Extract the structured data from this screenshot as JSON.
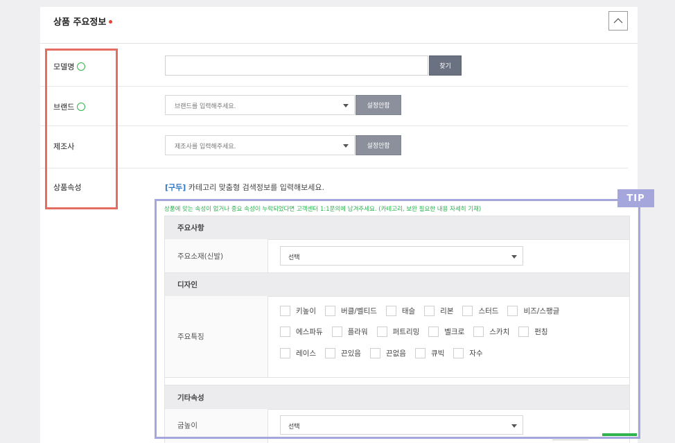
{
  "section": {
    "title": "상품 주요정보",
    "required_color": "#e8412f",
    "collapse_icon": "chevron-up-icon"
  },
  "fields": {
    "model": {
      "label": "모델명",
      "value": "",
      "search_button": "찾기"
    },
    "brand": {
      "label": "브랜드",
      "placeholder": "브랜드를 입력해주세요.",
      "setting_button": "설정안함"
    },
    "maker": {
      "label": "제조사",
      "placeholder": "제조사를 입력해주세요.",
      "setting_button": "설정안함"
    },
    "attributes": {
      "label": "상품속성",
      "guide_tag": "[구두]",
      "guide_text": " 카테고리 맞춤형 검색정보를 입력해보세요."
    }
  },
  "tip": {
    "badge": "TIP",
    "notice": "상품에 맞는 속성이 없거나 중요 속성이 누락되었다면 고객센터 1:1문의에 남겨주세요. (카테고리, 보완 필요한 내용 자세히 기재)",
    "color": "#a4a6dc"
  },
  "attribute_groups": [
    {
      "title": "주요사항",
      "rows": [
        {
          "label": "주요소재(신발)",
          "type": "select",
          "value": "선택"
        }
      ]
    },
    {
      "title": "디자인",
      "rows": [
        {
          "label": "주요특징",
          "type": "checkboxes",
          "lines": [
            [
              "키높이",
              "버클/벨티드",
              "태슬",
              "리본",
              "스터드",
              "비즈/스팽글"
            ],
            [
              "에스파듀",
              "플라워",
              "퍼트리밍",
              "벨크로",
              "스카치",
              "펀칭"
            ],
            [
              "레이스",
              "끈있음",
              "끈없음",
              "큐빅",
              "자수"
            ]
          ]
        }
      ]
    },
    {
      "title": "기타속성",
      "rows": [
        {
          "label": "굽높이",
          "type": "select",
          "value": "선택"
        }
      ]
    }
  ],
  "colors": {
    "ok_indicator": "#2fb34a",
    "highlight_red": "#e46c60",
    "guide_tag": "#2d77c8"
  }
}
